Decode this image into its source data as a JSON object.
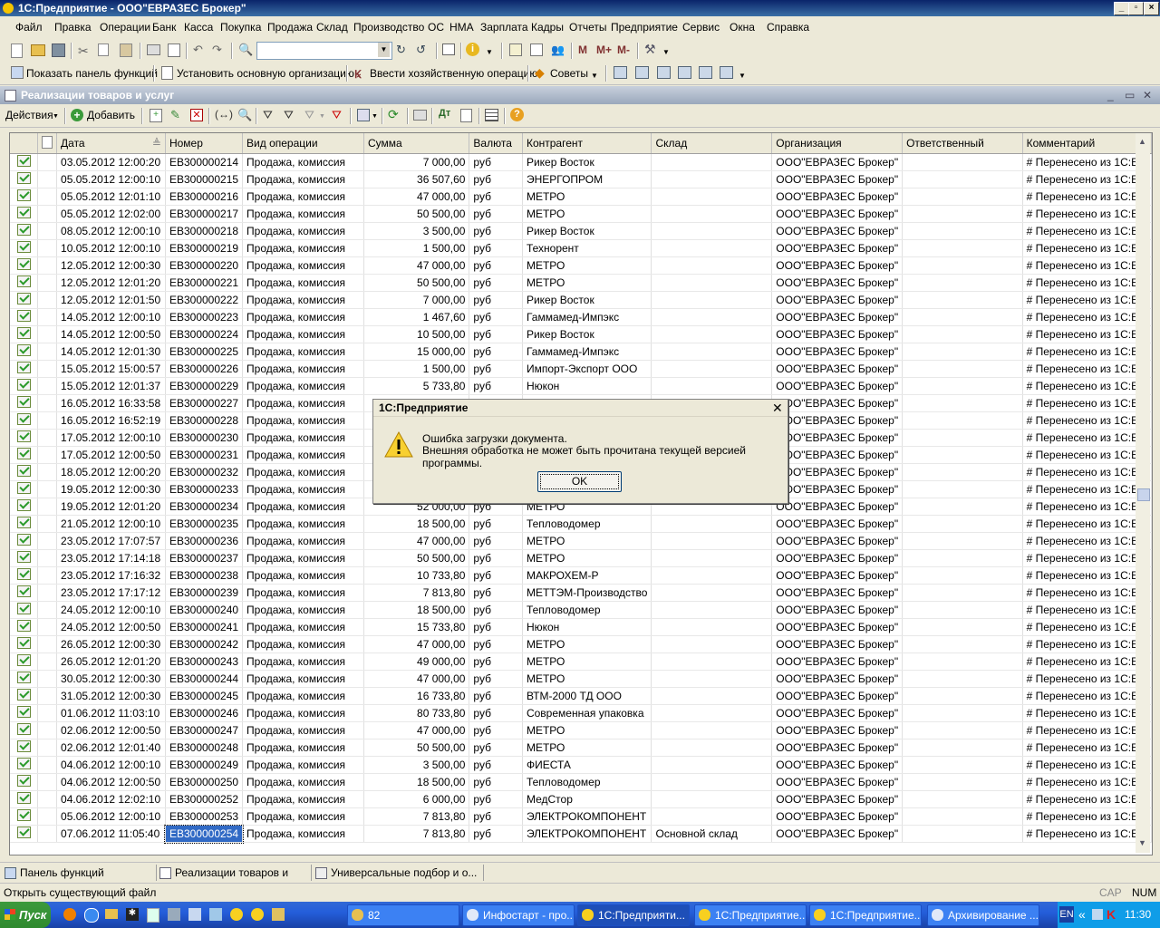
{
  "window": {
    "title": "1С:Предприятие - ООО\"ЕВРАЗЕС Брокер\""
  },
  "menu": [
    "Файл",
    "Правка",
    "Операции",
    "Банк",
    "Касса",
    "Покупка",
    "Продажа",
    "Склад",
    "Производство",
    "ОС",
    "НМА",
    "Зарплата",
    "Кадры",
    "Отчеты",
    "Предприятие",
    "Сервис",
    "Окна",
    "Справка"
  ],
  "toolbar2": {
    "show_panel": "Показать панель функций",
    "set_org": "Установить основную организацию",
    "enter_op": "Ввести хозяйственную операцию",
    "tips": "Советы"
  },
  "doc_window": {
    "title": "Реализации товаров и услуг",
    "actions_label": "Действия",
    "add_label": "Добавить"
  },
  "table": {
    "columns": [
      "Дата",
      "Номер",
      "Вид операции",
      "Сумма",
      "Валюта",
      "Контрагент",
      "Склад",
      "Организация",
      "Ответственный",
      "Комментарий"
    ],
    "rows": [
      [
        "03.05.2012 12:00:20",
        "ЕВ300000214",
        "Продажа, комиссия",
        "7 000,00",
        "руб",
        "Рикер Восток",
        "",
        "ООО\"ЕВРАЗЕС Брокер\"",
        "",
        "# Перенесено из 1С:Б..."
      ],
      [
        "05.05.2012 12:00:10",
        "ЕВ300000215",
        "Продажа, комиссия",
        "36 507,60",
        "руб",
        "ЭНЕРГОПРОМ",
        "",
        "ООО\"ЕВРАЗЕС Брокер\"",
        "",
        "# Перенесено из 1С:Б..."
      ],
      [
        "05.05.2012 12:01:10",
        "ЕВ300000216",
        "Продажа, комиссия",
        "47 000,00",
        "руб",
        "МЕТРО",
        "",
        "ООО\"ЕВРАЗЕС Брокер\"",
        "",
        "# Перенесено из 1С:Б..."
      ],
      [
        "05.05.2012 12:02:00",
        "ЕВ300000217",
        "Продажа, комиссия",
        "50 500,00",
        "руб",
        "МЕТРО",
        "",
        "ООО\"ЕВРАЗЕС Брокер\"",
        "",
        "# Перенесено из 1С:Б..."
      ],
      [
        "08.05.2012 12:00:10",
        "ЕВ300000218",
        "Продажа, комиссия",
        "3 500,00",
        "руб",
        "Рикер Восток",
        "",
        "ООО\"ЕВРАЗЕС Брокер\"",
        "",
        "# Перенесено из 1С:Б..."
      ],
      [
        "10.05.2012 12:00:10",
        "ЕВ300000219",
        "Продажа, комиссия",
        "1 500,00",
        "руб",
        "Технорент",
        "",
        "ООО\"ЕВРАЗЕС Брокер\"",
        "",
        "# Перенесено из 1С:Б..."
      ],
      [
        "12.05.2012 12:00:30",
        "ЕВ300000220",
        "Продажа, комиссия",
        "47 000,00",
        "руб",
        "МЕТРО",
        "",
        "ООО\"ЕВРАЗЕС Брокер\"",
        "",
        "# Перенесено из 1С:Б..."
      ],
      [
        "12.05.2012 12:01:20",
        "ЕВ300000221",
        "Продажа, комиссия",
        "50 500,00",
        "руб",
        "МЕТРО",
        "",
        "ООО\"ЕВРАЗЕС Брокер\"",
        "",
        "# Перенесено из 1С:Б..."
      ],
      [
        "12.05.2012 12:01:50",
        "ЕВ300000222",
        "Продажа, комиссия",
        "7 000,00",
        "руб",
        "Рикер Восток",
        "",
        "ООО\"ЕВРАЗЕС Брокер\"",
        "",
        "# Перенесено из 1С:Б..."
      ],
      [
        "14.05.2012 12:00:10",
        "ЕВ300000223",
        "Продажа, комиссия",
        "1 467,60",
        "руб",
        "Гаммамед-Импэкс",
        "",
        "ООО\"ЕВРАЗЕС Брокер\"",
        "",
        "# Перенесено из 1С:Б..."
      ],
      [
        "14.05.2012 12:00:50",
        "ЕВ300000224",
        "Продажа, комиссия",
        "10 500,00",
        "руб",
        "Рикер Восток",
        "",
        "ООО\"ЕВРАЗЕС Брокер\"",
        "",
        "# Перенесено из 1С:Б..."
      ],
      [
        "14.05.2012 12:01:30",
        "ЕВ300000225",
        "Продажа, комиссия",
        "15 000,00",
        "руб",
        "Гаммамед-Импэкс",
        "",
        "ООО\"ЕВРАЗЕС Брокер\"",
        "",
        "# Перенесено из 1С:Б..."
      ],
      [
        "15.05.2012 15:00:57",
        "ЕВ300000226",
        "Продажа, комиссия",
        "1 500,00",
        "руб",
        "Импорт-Экспорт ООО",
        "",
        "ООО\"ЕВРАЗЕС Брокер\"",
        "",
        "# Перенесено из 1С:Б..."
      ],
      [
        "15.05.2012 12:01:37",
        "ЕВ300000229",
        "Продажа, комиссия",
        "5 733,80",
        "руб",
        "Нюкон",
        "",
        "ООО\"ЕВРАЗЕС Брокер\"",
        "",
        "# Перенесено из 1С:Б..."
      ],
      [
        "16.05.2012 16:33:58",
        "ЕВ300000227",
        "Продажа, комиссия",
        "",
        "",
        "",
        "",
        "ООО\"ЕВРАЗЕС Брокер\"",
        "",
        "# Перенесено из 1С:Б..."
      ],
      [
        "16.05.2012 16:52:19",
        "ЕВ300000228",
        "Продажа, комиссия",
        "",
        "",
        "",
        "",
        "ООО\"ЕВРАЗЕС Брокер\"",
        "",
        "# Перенесено из 1С:Б..."
      ],
      [
        "17.05.2012 12:00:10",
        "ЕВ300000230",
        "Продажа, комиссия",
        "",
        "",
        "",
        "",
        "ООО\"ЕВРАЗЕС Брокер\"",
        "",
        "# Перенесено из 1С:Б..."
      ],
      [
        "17.05.2012 12:00:50",
        "ЕВ300000231",
        "Продажа, комиссия",
        "",
        "",
        "",
        "",
        "ООО\"ЕВРАЗЕС Брокер\"",
        "",
        "# Перенесено из 1С:Б..."
      ],
      [
        "18.05.2012 12:00:20",
        "ЕВ300000232",
        "Продажа, комиссия",
        "",
        "",
        "",
        "",
        "ООО\"ЕВРАЗЕС Брокер\"",
        "",
        "# Перенесено из 1С:Б..."
      ],
      [
        "19.05.2012 12:00:30",
        "ЕВ300000233",
        "Продажа, комиссия",
        "",
        "",
        "",
        "",
        "ООО\"ЕВРАЗЕС Брокер\"",
        "",
        "# Перенесено из 1С:Б..."
      ],
      [
        "19.05.2012 12:01:20",
        "ЕВ300000234",
        "Продажа, комиссия",
        "52 000,00",
        "руб",
        "МЕТРО",
        "",
        "ООО\"ЕВРАЗЕС Брокер\"",
        "",
        "# Перенесено из 1С:Б..."
      ],
      [
        "21.05.2012 12:00:10",
        "ЕВ300000235",
        "Продажа, комиссия",
        "18 500,00",
        "руб",
        "Тепловодомер",
        "",
        "ООО\"ЕВРАЗЕС Брокер\"",
        "",
        "# Перенесено из 1С:Б..."
      ],
      [
        "23.05.2012 17:07:57",
        "ЕВ300000236",
        "Продажа, комиссия",
        "47 000,00",
        "руб",
        "МЕТРО",
        "",
        "ООО\"ЕВРАЗЕС Брокер\"",
        "",
        "# Перенесено из 1С:Б..."
      ],
      [
        "23.05.2012 17:14:18",
        "ЕВ300000237",
        "Продажа, комиссия",
        "50 500,00",
        "руб",
        "МЕТРО",
        "",
        "ООО\"ЕВРАЗЕС Брокер\"",
        "",
        "# Перенесено из 1С:Б..."
      ],
      [
        "23.05.2012 17:16:32",
        "ЕВ300000238",
        "Продажа, комиссия",
        "10 733,80",
        "руб",
        "МАКРОХЕМ-Р",
        "",
        "ООО\"ЕВРАЗЕС Брокер\"",
        "",
        "# Перенесено из 1С:Б..."
      ],
      [
        "23.05.2012 17:17:12",
        "ЕВ300000239",
        "Продажа, комиссия",
        "7 813,80",
        "руб",
        "МЕТТЭМ-Производство",
        "",
        "ООО\"ЕВРАЗЕС Брокер\"",
        "",
        "# Перенесено из 1С:Б..."
      ],
      [
        "24.05.2012 12:00:10",
        "ЕВ300000240",
        "Продажа, комиссия",
        "18 500,00",
        "руб",
        "Тепловодомер",
        "",
        "ООО\"ЕВРАЗЕС Брокер\"",
        "",
        "# Перенесено из 1С:Б..."
      ],
      [
        "24.05.2012 12:00:50",
        "ЕВ300000241",
        "Продажа, комиссия",
        "15 733,80",
        "руб",
        "Нюкон",
        "",
        "ООО\"ЕВРАЗЕС Брокер\"",
        "",
        "# Перенесено из 1С:Б..."
      ],
      [
        "26.05.2012 12:00:30",
        "ЕВ300000242",
        "Продажа, комиссия",
        "47 000,00",
        "руб",
        "МЕТРО",
        "",
        "ООО\"ЕВРАЗЕС Брокер\"",
        "",
        "# Перенесено из 1С:Б..."
      ],
      [
        "26.05.2012 12:01:20",
        "ЕВ300000243",
        "Продажа, комиссия",
        "49 000,00",
        "руб",
        "МЕТРО",
        "",
        "ООО\"ЕВРАЗЕС Брокер\"",
        "",
        "# Перенесено из 1С:Б..."
      ],
      [
        "30.05.2012 12:00:30",
        "ЕВ300000244",
        "Продажа, комиссия",
        "47 000,00",
        "руб",
        "МЕТРО",
        "",
        "ООО\"ЕВРАЗЕС Брокер\"",
        "",
        "# Перенесено из 1С:Б..."
      ],
      [
        "31.05.2012 12:00:30",
        "ЕВ300000245",
        "Продажа, комиссия",
        "16 733,80",
        "руб",
        "ВТМ-2000 ТД ООО",
        "",
        "ООО\"ЕВРАЗЕС Брокер\"",
        "",
        "# Перенесено из 1С:Б..."
      ],
      [
        "01.06.2012 11:03:10",
        "ЕВ300000246",
        "Продажа, комиссия",
        "80 733,80",
        "руб",
        "Современная упаковка",
        "",
        "ООО\"ЕВРАЗЕС Брокер\"",
        "",
        "# Перенесено из 1С:Б..."
      ],
      [
        "02.06.2012 12:00:50",
        "ЕВ300000247",
        "Продажа, комиссия",
        "47 000,00",
        "руб",
        "МЕТРО",
        "",
        "ООО\"ЕВРАЗЕС Брокер\"",
        "",
        "# Перенесено из 1С:Б..."
      ],
      [
        "02.06.2012 12:01:40",
        "ЕВ300000248",
        "Продажа, комиссия",
        "50 500,00",
        "руб",
        "МЕТРО",
        "",
        "ООО\"ЕВРАЗЕС Брокер\"",
        "",
        "# Перенесено из 1С:Б..."
      ],
      [
        "04.06.2012 12:00:10",
        "ЕВ300000249",
        "Продажа, комиссия",
        "3 500,00",
        "руб",
        "ФИЕСТА",
        "",
        "ООО\"ЕВРАЗЕС Брокер\"",
        "",
        "# Перенесено из 1С:Б..."
      ],
      [
        "04.06.2012 12:00:50",
        "ЕВ300000250",
        "Продажа, комиссия",
        "18 500,00",
        "руб",
        "Тепловодомер",
        "",
        "ООО\"ЕВРАЗЕС Брокер\"",
        "",
        "# Перенесено из 1С:Б..."
      ],
      [
        "04.06.2012 12:02:10",
        "ЕВ300000252",
        "Продажа, комиссия",
        "6 000,00",
        "руб",
        "МедСтор",
        "",
        "ООО\"ЕВРАЗЕС Брокер\"",
        "",
        "# Перенесено из 1С:Б..."
      ],
      [
        "05.06.2012 12:00:10",
        "ЕВ300000253",
        "Продажа, комиссия",
        "7 813,80",
        "руб",
        "ЭЛЕКТРОКОМПОНЕНТ",
        "",
        "ООО\"ЕВРАЗЕС Брокер\"",
        "",
        "# Перенесено из 1С:Б..."
      ],
      [
        "07.06.2012 11:05:40",
        "ЕВ300000254",
        "Продажа, комиссия",
        "7 813,80",
        "руб",
        "ЭЛЕКТРОКОМПОНЕНТ",
        "Основной склад",
        "ООО\"ЕВРАЗЕС Брокер\"",
        "",
        "# Перенесено из 1С:Б..."
      ]
    ]
  },
  "dialog": {
    "title": "1С:Предприятие",
    "line1": "Ошибка загрузки документа.",
    "line2": "Внешняя обработка не может быть прочитана текущей версией программы.",
    "ok": "OK"
  },
  "window_tabs": [
    "Панель функций",
    "Реализации товаров и услуг",
    "Универсальные подбор и о..."
  ],
  "status": {
    "text": "Открыть существующий файл",
    "cap": "CAP",
    "num": "NUM"
  },
  "taskbar": {
    "start": "Пуск",
    "tasks": [
      "82",
      "Инфостарт - про...",
      "1С:Предприяти...",
      "1С:Предприятие...",
      "1С:Предприятие...",
      "Архивирование ..."
    ],
    "lang": "EN",
    "time": "11:30"
  }
}
